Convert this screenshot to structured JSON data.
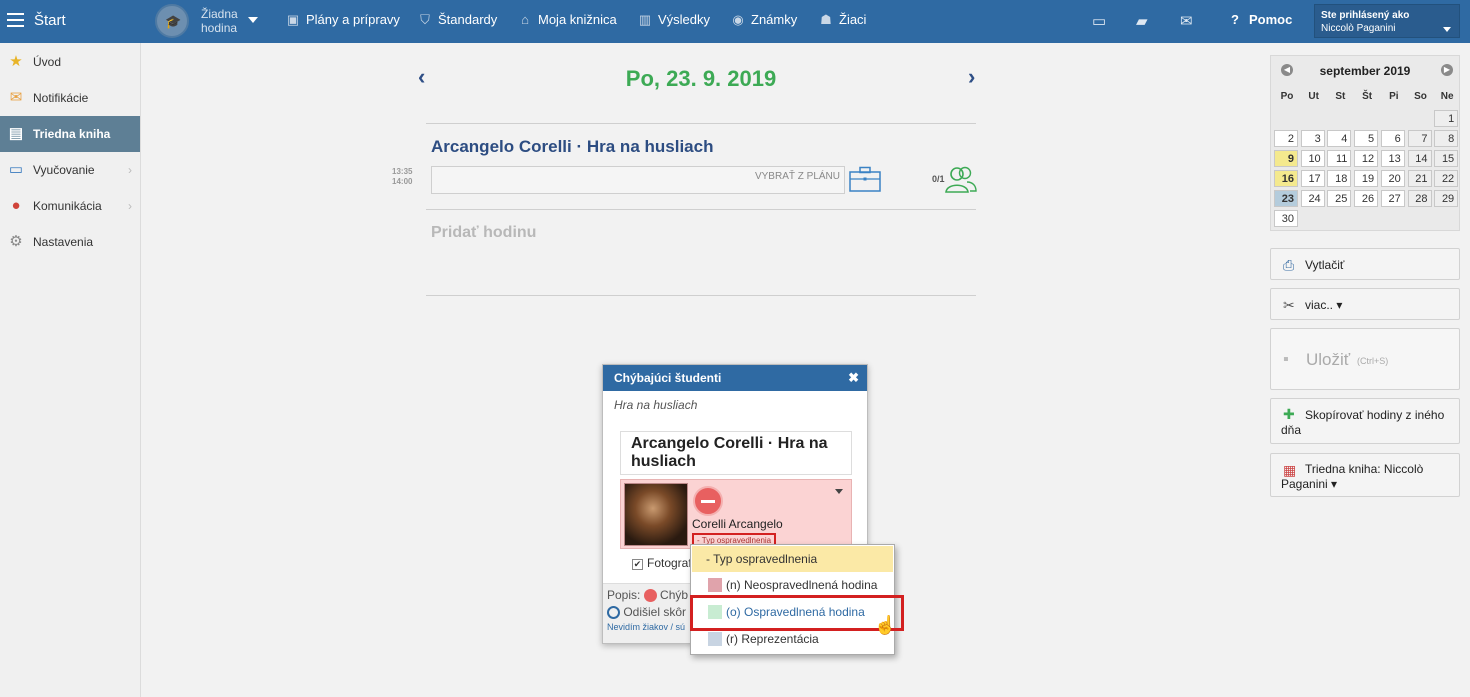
{
  "topbar": {
    "start_label": "Štart",
    "lesson_selector": "Žiadna hodina",
    "nav": [
      {
        "label": "Plány a prípravy",
        "icon": "briefcase-icon"
      },
      {
        "label": "Štandardy",
        "icon": "shield-icon"
      },
      {
        "label": "Moja knižnica",
        "icon": "library-icon"
      },
      {
        "label": "Výsledky",
        "icon": "bar-chart-icon"
      },
      {
        "label": "Známky",
        "icon": "grades-icon"
      },
      {
        "label": "Žiaci",
        "icon": "students-icon"
      }
    ],
    "help_label": "Pomoc",
    "user_line1": "Ste prihlásený ako",
    "user_line2": "Niccolò Paganini"
  },
  "sidebar": {
    "items": [
      {
        "label": "Úvod",
        "icon": "star-icon"
      },
      {
        "label": "Notifikácie",
        "icon": "envelope-icon"
      },
      {
        "label": "Triedna kniha",
        "icon": "book-icon"
      },
      {
        "label": "Vyučovanie",
        "icon": "open-book-icon"
      },
      {
        "label": "Komunikácia",
        "icon": "chat-icon"
      },
      {
        "label": "Nastavenia",
        "icon": "gear-icon"
      }
    ]
  },
  "main": {
    "date": "Po, 23. 9. 2019",
    "lesson_title": "Arcangelo Corelli · Hra na husliach",
    "time_start": "13:35",
    "time_end": "14:00",
    "plan_placeholder": "VYBRAŤ Z PLÁNU",
    "attendance_count": "0/1",
    "add_lesson": "Pridať hodinu"
  },
  "calendar": {
    "month": "september 2019",
    "day_names": [
      "Po",
      "Ut",
      "St",
      "Št",
      "Pi",
      "So",
      "Ne"
    ],
    "days": [
      "1",
      "2",
      "3",
      "4",
      "5",
      "6",
      "7",
      "8",
      "9",
      "10",
      "11",
      "12",
      "13",
      "14",
      "15",
      "16",
      "17",
      "18",
      "19",
      "20",
      "21",
      "22",
      "23",
      "24",
      "25",
      "26",
      "27",
      "28",
      "29",
      "30"
    ],
    "marked_days": [
      "9",
      "16"
    ],
    "selected_day": "23"
  },
  "right_panel": {
    "print": "Vytlačiť",
    "more": "viac.. ▾",
    "save": "Uložiť",
    "save_shortcut": "(Ctrl+S)",
    "copy": "Skopírovať hodiny z iného dňa",
    "classbook": "Triedna kniha: Niccolò Paganini ▾"
  },
  "dialog": {
    "title": "Chýbajúci študenti",
    "subtitle": "Hra na husliach",
    "lesson_card": "Arcangelo Corelli · Hra na husliach",
    "student_name": "Corelli Arcangelo",
    "excuse_type": "- Typ ospravedlnenia",
    "photo_checkbox": "Fotograf",
    "legend_line1": "Popis:",
    "legend_absent": "Chýb",
    "legend_left": "Odišiel skôr",
    "legend_note": "Nevidím žiakov / sú"
  },
  "dropdown": {
    "options": [
      {
        "label": "- Typ ospravedlnenia",
        "color": ""
      },
      {
        "label": "(n) Neospravedlnená hodina",
        "color": "#e0a3ab"
      },
      {
        "label": "(o) Ospravedlnená hodina",
        "color": "#c8ecd2"
      },
      {
        "label": "(r) Reprezentácia",
        "color": "#c8d4e2"
      }
    ]
  },
  "colors": {
    "topbar": "#2f6aa3",
    "date_green": "#3daa55",
    "lesson_blue": "#2d4d82",
    "highlight_red": "#d32020"
  }
}
